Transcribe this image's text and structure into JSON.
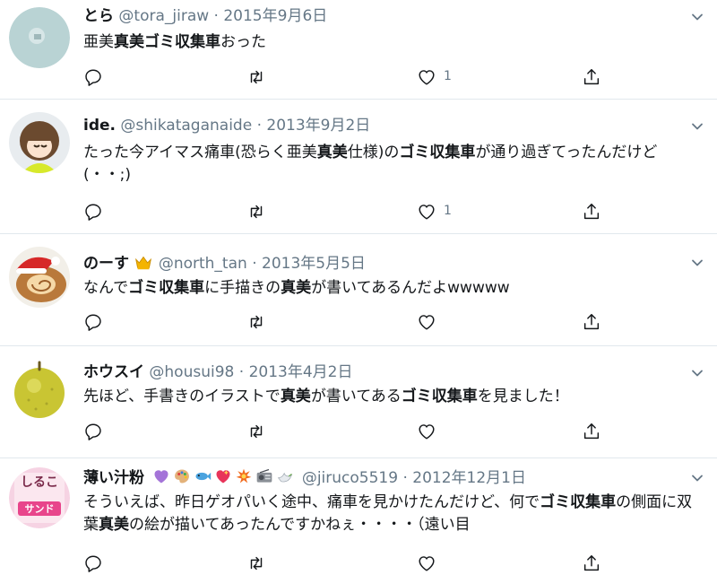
{
  "tweets": [
    {
      "name": "とら",
      "handle": "@tora_jiraw",
      "separator": "·",
      "date": "2015年9月6日",
      "text_parts": [
        "亜美",
        "真美ゴミ収集車",
        "おった"
      ],
      "like_count": "1"
    },
    {
      "name": "ide.",
      "handle": "@shikataganaide",
      "separator": "·",
      "date": "2013年9月2日",
      "text_parts": [
        "たった今アイマス痛車(恐らく亜美",
        "真美",
        "仕様)の",
        "ゴミ収集車",
        "が通り過ぎてったんだけど(・・;)"
      ],
      "like_count": "1"
    },
    {
      "name": "のーす",
      "handle": "@north_tan",
      "separator": "·",
      "date": "2013年5月5日",
      "text_parts": [
        "なんで",
        "ゴミ収集車",
        "に手描きの",
        "真美",
        "が書いてあるんだよwwwww"
      ],
      "like_count": ""
    },
    {
      "name": "ホウスイ",
      "handle": "@housui98",
      "separator": "·",
      "date": "2013年4月2日",
      "text_parts": [
        "先ほど、手書きのイラストで",
        "真美",
        "が書いてある",
        "ゴミ収集車",
        "を見ました！"
      ],
      "like_count": ""
    },
    {
      "name": "薄い汁粉",
      "handle": "@jiruco5519",
      "separator": "·",
      "date": "2012年12月1日",
      "text_parts": [
        "そういえば、昨日ゲオパいく途中、痛車を見かけたんだけど、何で",
        "ゴミ収集車",
        "の側面に双葉",
        "真美",
        "の絵が描いてあったんですかねぇ・・・・（遠い目"
      ],
      "like_count": "",
      "emoji_icons": [
        "purple-heart-icon",
        "palette-icon",
        "fish-icon",
        "sparkling-heart-icon",
        "collision-icon",
        "radio-icon",
        "dove-icon"
      ],
      "avatar_text": [
        "しるこ",
        "サンド"
      ]
    }
  ],
  "icons": {
    "reply": "reply-icon",
    "retweet": "retweet-icon",
    "like": "heart-icon",
    "share": "share-icon",
    "menu": "chevron-down-icon",
    "crown": "crown-icon"
  },
  "colors": {
    "name": "#14171a",
    "meta": "#657786",
    "divider": "#e1e8ed"
  }
}
